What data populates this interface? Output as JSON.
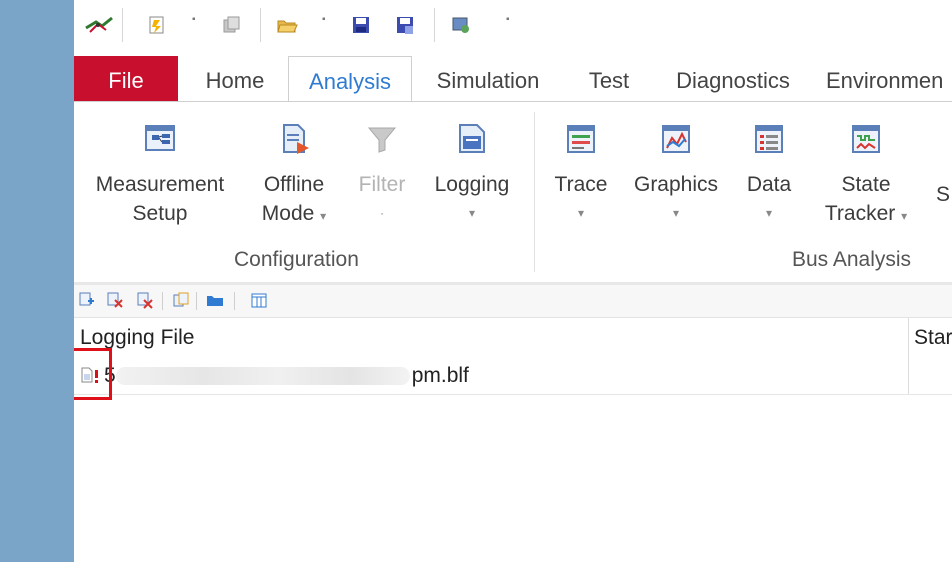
{
  "ribbon_tabs": [
    "File",
    "Home",
    "Analysis",
    "Simulation",
    "Test",
    "Diagnostics",
    "Environmen"
  ],
  "ribbon": {
    "configuration": {
      "label": "Configuration",
      "buttons": [
        {
          "line1": "Measurement",
          "line2": "Setup",
          "caret": ""
        },
        {
          "line1": "Offline",
          "line2": "Mode",
          "caret": "▾"
        },
        {
          "line1": "Filter",
          "line2": "",
          "caret": "·"
        },
        {
          "line1": "Logging",
          "line2": "",
          "caret": "▾"
        }
      ]
    },
    "bus_analysis": {
      "label": "Bus Analysis",
      "buttons": [
        {
          "line1": "Trace",
          "line2": "",
          "caret": "▾"
        },
        {
          "line1": "Graphics",
          "line2": "",
          "caret": "▾"
        },
        {
          "line1": "Data",
          "line2": "",
          "caret": "▾"
        },
        {
          "line1": "State",
          "line2": "Tracker",
          "caret": "▾"
        },
        {
          "line1": "",
          "line2": "S",
          "caret": ""
        }
      ]
    }
  },
  "table": {
    "columns": [
      "Logging File",
      "Star"
    ],
    "rows": [
      {
        "name_prefix": "5",
        "name_suffix": "pm.blf",
        "status_mark": "!"
      }
    ]
  },
  "colors": {
    "file_tab": "#c8102e",
    "active_tab_text": "#2f7bd1",
    "highlight_box": "#e0101a",
    "left_panel": "#7aa5c8"
  },
  "icons": [
    "app-logo-icon",
    "new-config-icon",
    "copy-icon",
    "open-folder-icon",
    "save-icon",
    "save-as-icon",
    "configure-icon",
    "customize-icon"
  ]
}
